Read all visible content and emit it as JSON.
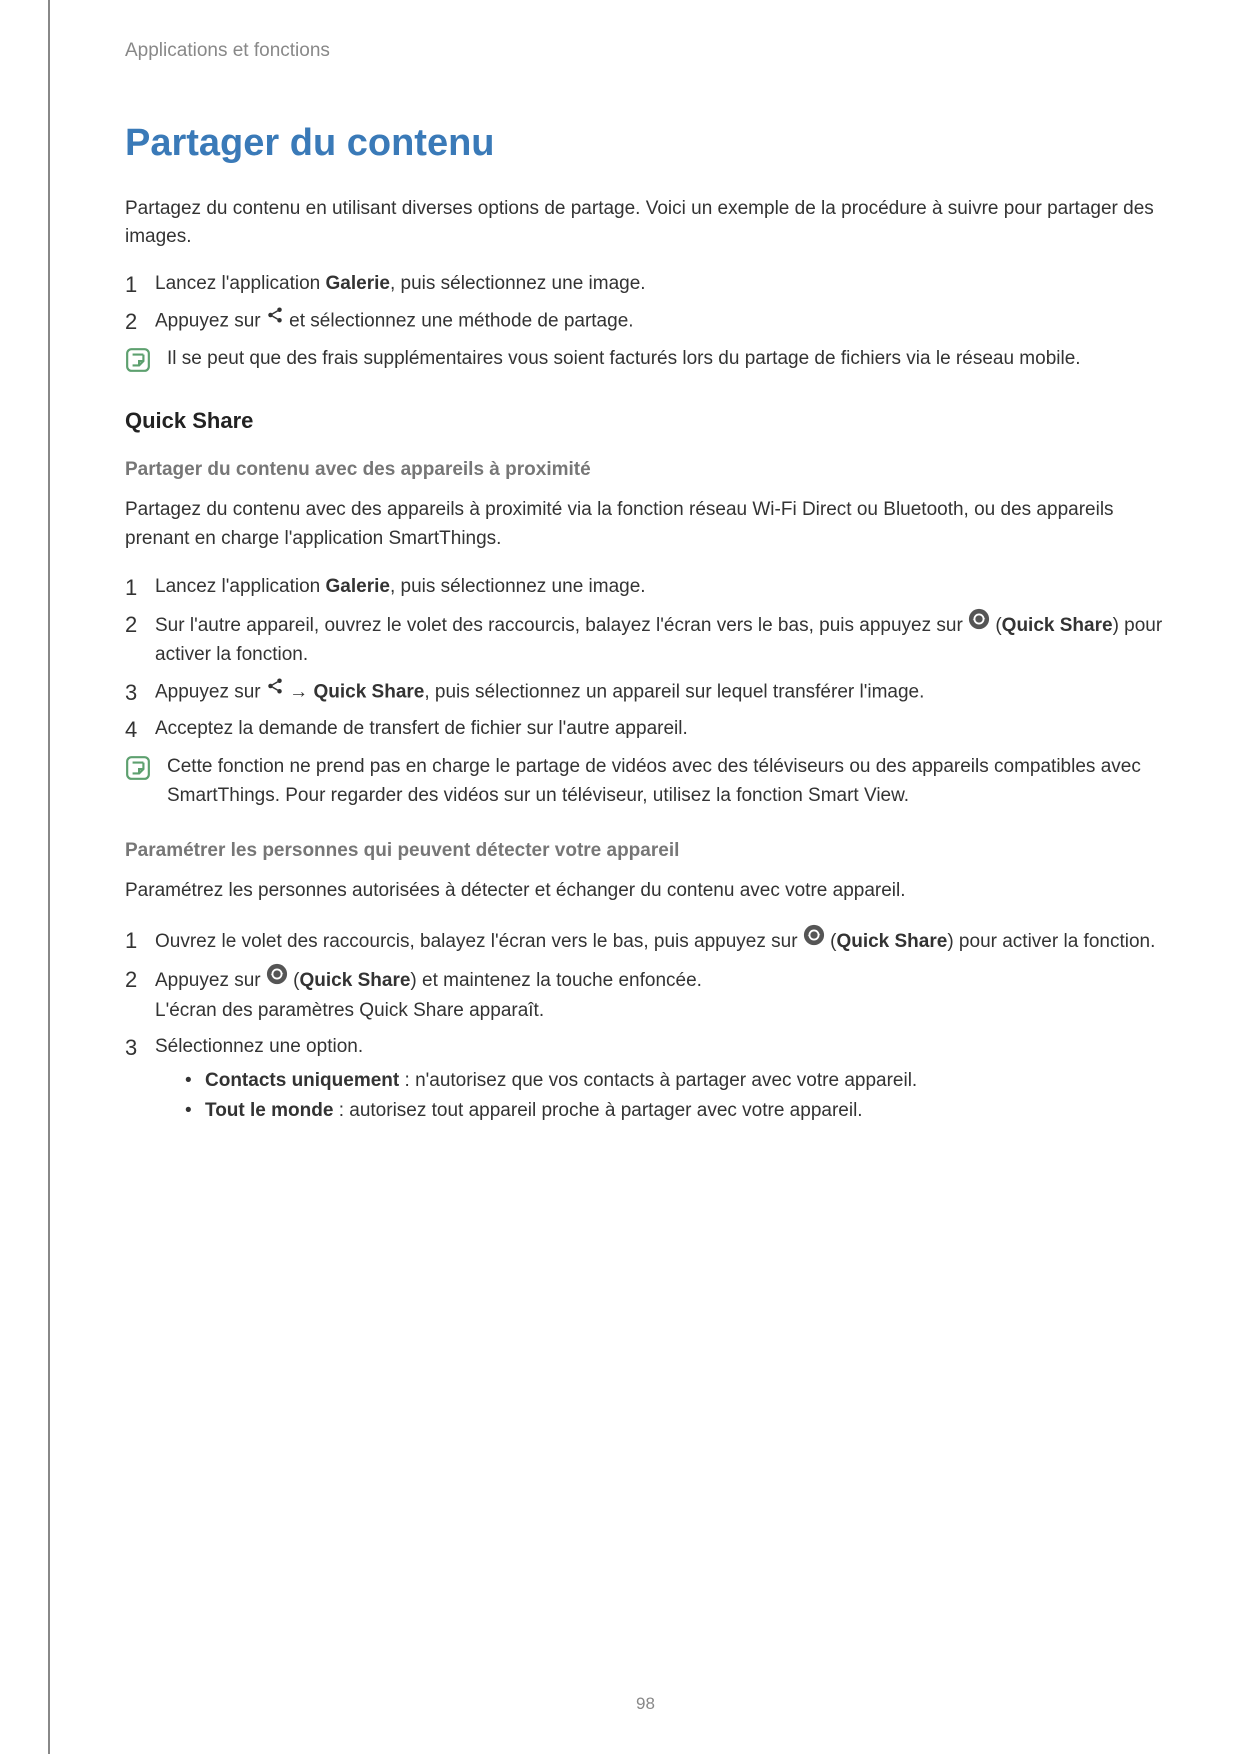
{
  "breadcrumb": "Applications et fonctions",
  "title": "Partager du contenu",
  "intro": "Partagez du contenu en utilisant diverses options de partage. Voici un exemple de la procédure à suivre pour partager des images.",
  "steps1": {
    "n1": "1",
    "s1a": "Lancez l'application ",
    "s1b": "Galerie",
    "s1c": ", puis sélectionnez une image.",
    "n2": "2",
    "s2a": "Appuyez sur ",
    "s2b": " et sélectionnez une méthode de partage."
  },
  "note1": "Il se peut que des frais supplémentaires vous soient facturés lors du partage de fichiers via le réseau mobile.",
  "h2": "Quick Share",
  "h3a": "Partager du contenu avec des appareils à proximité",
  "p2": "Partagez du contenu avec des appareils à proximité via la fonction réseau Wi-Fi Direct ou Bluetooth, ou des appareils prenant en charge l'application SmartThings.",
  "qs": {
    "n1": "1",
    "s1a": "Lancez l'application ",
    "s1b": "Galerie",
    "s1c": ", puis sélectionnez une image.",
    "n2": "2",
    "s2a": "Sur l'autre appareil, ouvrez le volet des raccourcis, balayez l'écran vers le bas, puis appuyez sur ",
    "s2b": " (",
    "s2c": "Quick Share",
    "s2d": ") pour activer la fonction.",
    "n3": "3",
    "s3a": "Appuyez sur ",
    "s3b": " → ",
    "s3c": "Quick Share",
    "s3d": ", puis sélectionnez un appareil sur lequel transférer l'image.",
    "n4": "4",
    "s4": "Acceptez la demande de transfert de fichier sur l'autre appareil."
  },
  "note2": "Cette fonction ne prend pas en charge le partage de vidéos avec des téléviseurs ou des appareils compatibles avec SmartThings. Pour regarder des vidéos sur un téléviseur, utilisez la fonction Smart View.",
  "h3b": "Paramétrer les personnes qui peuvent détecter votre appareil",
  "p3": "Paramétrez les personnes autorisées à détecter et échanger du contenu avec votre appareil.",
  "ps": {
    "n1": "1",
    "s1a": "Ouvrez le volet des raccourcis, balayez l'écran vers le bas, puis appuyez sur ",
    "s1b": " (",
    "s1c": "Quick Share",
    "s1d": ") pour activer la fonction.",
    "n2": "2",
    "s2a": "Appuyez sur ",
    "s2b": " (",
    "s2c": "Quick Share",
    "s2d": ") et maintenez la touche enfoncée.",
    "s2e": "L'écran des paramètres Quick Share apparaît.",
    "n3": "3",
    "s3": "Sélectionnez une option.",
    "b1a": "Contacts uniquement",
    "b1b": " : n'autorisez que vos contacts à partager avec votre appareil.",
    "b2a": "Tout le monde",
    "b2b": " : autorisez tout appareil proche à partager avec votre appareil."
  },
  "pageNumber": "98"
}
